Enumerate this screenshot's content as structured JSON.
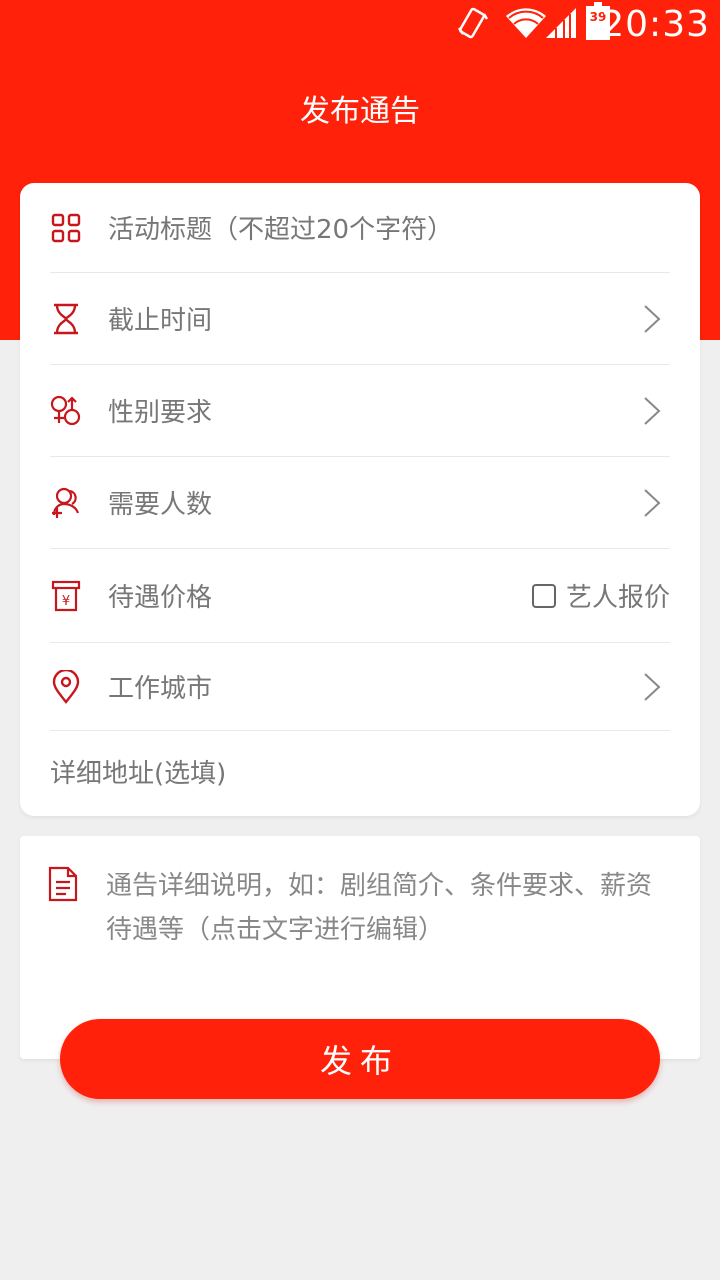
{
  "status_bar": {
    "time": "20:33",
    "battery_level": "39"
  },
  "header": {
    "title": "发布通告"
  },
  "form": {
    "rows": [
      {
        "label": "活动标题（不超过20个字符）",
        "icon": "grid-icon",
        "chevron": false
      },
      {
        "label": "截止时间",
        "icon": "hourglass-icon",
        "chevron": true
      },
      {
        "label": "性别要求",
        "icon": "gender-icon",
        "chevron": true
      },
      {
        "label": "需要人数",
        "icon": "add-people-icon",
        "chevron": true
      },
      {
        "label": "待遇价格",
        "icon": "price-icon",
        "chevron": false
      },
      {
        "label": "工作城市",
        "icon": "location-pin-icon",
        "chevron": true
      },
      {
        "label": "详细地址(选填)",
        "icon": "",
        "chevron": false
      }
    ],
    "artist_quote_label": "艺人报价",
    "artist_quote_checked": false
  },
  "description": {
    "text": "通告详细说明，如：剧组简介、条件要求、薪资待遇等（点击文字进行编辑）",
    "icon": "document-icon"
  },
  "publish_button": {
    "label": "发布"
  },
  "colors": {
    "primary": "#ff2109",
    "icon": "#c8161d",
    "text_muted": "#777777",
    "background": "#efefef"
  }
}
